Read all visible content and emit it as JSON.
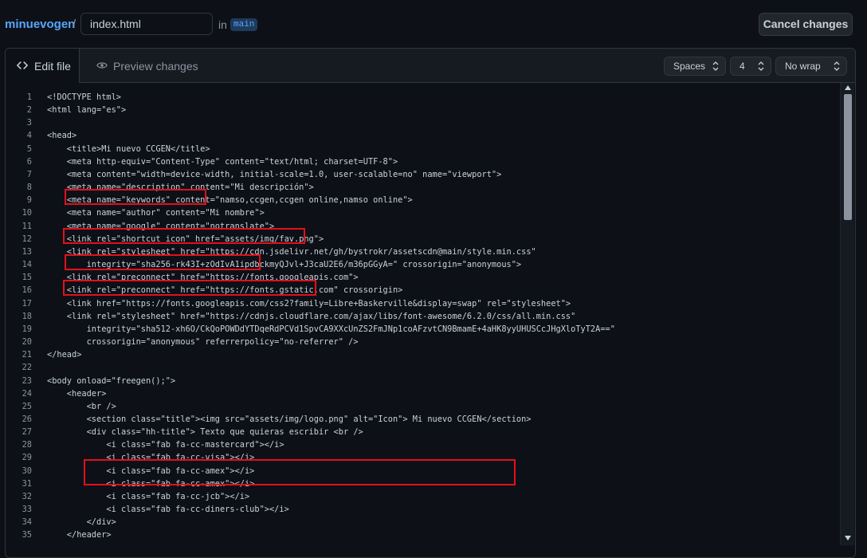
{
  "header": {
    "repo": "minuevogen",
    "separator": "/",
    "filename": "index.html",
    "in_label": "in",
    "branch": "main",
    "cancel_label": "Cancel changes"
  },
  "tabs": {
    "edit_label": "Edit file",
    "preview_label": "Preview changes"
  },
  "options": {
    "indent_mode": "Spaces",
    "indent_size": "4",
    "wrap_mode": "No wrap"
  },
  "colors": {
    "background": "#0d1117",
    "link": "#58a6ff",
    "highlight_box": "#e3101b"
  },
  "code_lines": [
    {
      "num": "1",
      "text": "<!DOCTYPE html>"
    },
    {
      "num": "2",
      "text": "<html lang=\"es\">"
    },
    {
      "num": "3",
      "text": ""
    },
    {
      "num": "4",
      "text": "<head>"
    },
    {
      "num": "5",
      "text": "    <title>Mi nuevo CCGEN</title>"
    },
    {
      "num": "6",
      "text": "    <meta http-equiv=\"Content-Type\" content=\"text/html; charset=UTF-8\">"
    },
    {
      "num": "7",
      "text": "    <meta content=\"width=device-width, initial-scale=1.0, user-scalable=no\" name=\"viewport\">"
    },
    {
      "num": "8",
      "text": "    <meta name=\"description\" content=\"Mi descripción\">"
    },
    {
      "num": "9",
      "text": "    <meta name=\"keywords\" content=\"namso,ccgen,ccgen online,namso online\">"
    },
    {
      "num": "10",
      "text": "    <meta name=\"author\" content=\"Mi nombre\">"
    },
    {
      "num": "11",
      "text": "    <meta name=\"google\" content=\"notranslate\">"
    },
    {
      "num": "12",
      "text": "    <link rel=\"shortcut icon\" href=\"assets/img/fav.png\">"
    },
    {
      "num": "13",
      "text": "    <link rel=\"stylesheet\" href=\"https://cdn.jsdelivr.net/gh/bystrokr/assetscdn@main/style.min.css\""
    },
    {
      "num": "14",
      "text": "        integrity=\"sha256-rk43I+zOdIvA1ipdbckmyQJvl+J3caU2E6/m36pGGyA=\" crossorigin=\"anonymous\">"
    },
    {
      "num": "15",
      "text": "    <link rel=\"preconnect\" href=\"https://fonts.googleapis.com\">"
    },
    {
      "num": "16",
      "text": "    <link rel=\"preconnect\" href=\"https://fonts.gstatic.com\" crossorigin>"
    },
    {
      "num": "17",
      "text": "    <link href=\"https://fonts.googleapis.com/css2?family=Libre+Baskerville&display=swap\" rel=\"stylesheet\">"
    },
    {
      "num": "18",
      "text": "    <link rel=\"stylesheet\" href=\"https://cdnjs.cloudflare.com/ajax/libs/font-awesome/6.2.0/css/all.min.css\""
    },
    {
      "num": "19",
      "text": "        integrity=\"sha512-xh6O/CkQoPOWDdYTDqeRdPCVd1SpvCA9XXcUnZS2FmJNp1coAFzvtCN9BmamE+4aHK8yyUHUSCcJHgXloTyT2A==\""
    },
    {
      "num": "20",
      "text": "        crossorigin=\"anonymous\" referrerpolicy=\"no-referrer\" />"
    },
    {
      "num": "21",
      "text": "</head>"
    },
    {
      "num": "22",
      "text": ""
    },
    {
      "num": "23",
      "text": "<body onload=\"freegen();\">"
    },
    {
      "num": "24",
      "text": "    <header>"
    },
    {
      "num": "25",
      "text": "        <br />"
    },
    {
      "num": "26",
      "text": "        <section class=\"title\"><img src=\"assets/img/logo.png\" alt=\"Icon\"> Mi nuevo CCGEN</section>"
    },
    {
      "num": "27",
      "text": "        <div class=\"hh-title\"> Texto que quieras escribir <br />"
    },
    {
      "num": "28",
      "text": "            <i class=\"fab fa-cc-mastercard\"></i>"
    },
    {
      "num": "29",
      "text": "            <i class=\"fab fa-cc-visa\"></i>"
    },
    {
      "num": "30",
      "text": "            <i class=\"fab fa-cc-amex\"></i>"
    },
    {
      "num": "31",
      "text": "            <i class=\"fab fa-cc-amex\"></i>"
    },
    {
      "num": "32",
      "text": "            <i class=\"fab fa-cc-jcb\"></i>"
    },
    {
      "num": "33",
      "text": "            <i class=\"fab fa-cc-diners-club\"></i>"
    },
    {
      "num": "34",
      "text": "        </div>"
    },
    {
      "num": "35",
      "text": "    </header>"
    }
  ]
}
